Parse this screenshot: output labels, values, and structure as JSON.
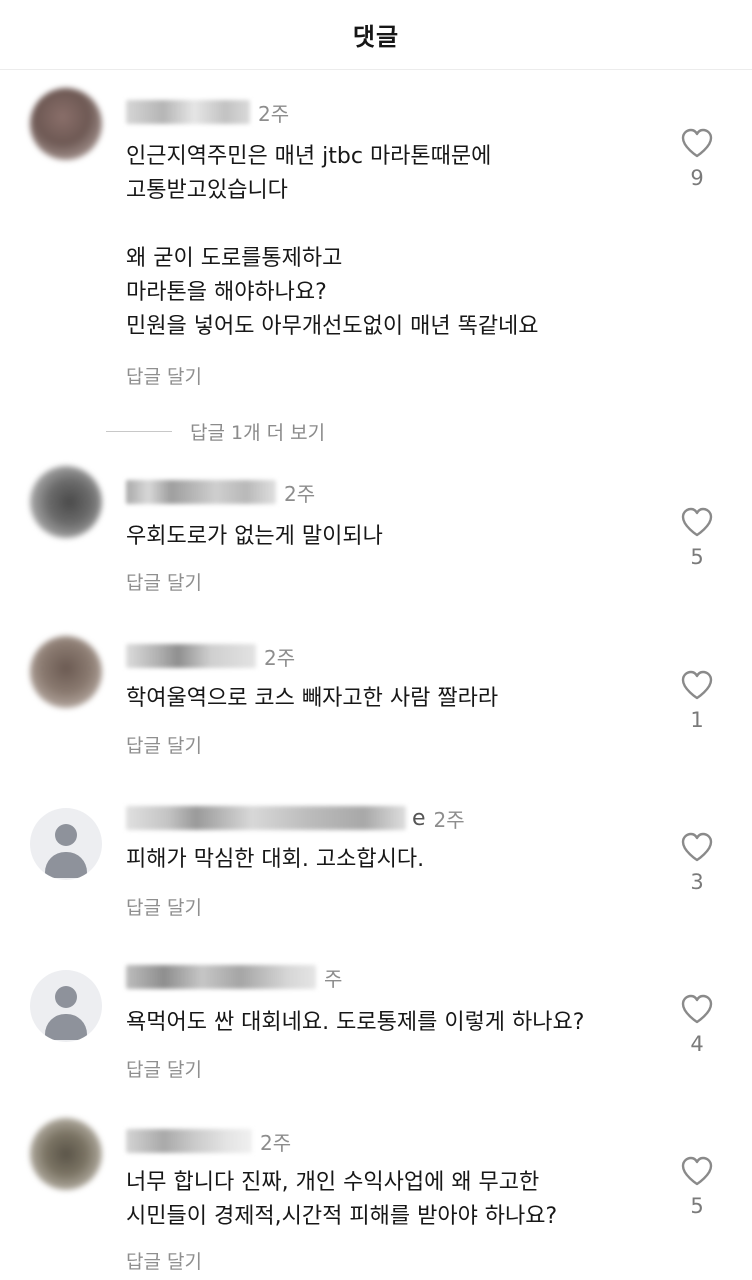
{
  "header": {
    "title": "댓글"
  },
  "reply_label": "답글 달기",
  "more_replies": "답글 1개 더 보기",
  "comments": [
    {
      "time": "2주",
      "suffix": "",
      "text": "인근지역주민은 매년 jtbc 마라톤때문에\n고통받고있습니다\n\n왜 굳이 도로를통제하고\n마라톤을 해야하나요?\n민원을 넣어도 아무개선도없이 매년 똑같네요",
      "likes": "9"
    },
    {
      "time": "2주",
      "suffix": "",
      "text": "우회도로가 없는게 말이되나",
      "likes": "5"
    },
    {
      "time": "2주",
      "suffix": "",
      "text": "학여울역으로 코스 빼자고한 사람 짤라라",
      "likes": "1"
    },
    {
      "time": "2주",
      "suffix": "e",
      "text": "피해가 막심한 대회. 고소합시다.",
      "likes": "3"
    },
    {
      "time": "주",
      "suffix": "",
      "text": "욕먹어도 싼 대회네요. 도로통제를 이렇게 하나요?",
      "likes": "4"
    },
    {
      "time": "2주",
      "suffix": "",
      "text": "너무 합니다 진짜, 개인 수익사업에 왜 무고한\n시민들이 경제적,시간적 피해를 받아야 하나요?",
      "likes": "5"
    }
  ],
  "colors": {
    "like_icon": "#8a8a8a",
    "default_avatar": "#8e929b"
  }
}
